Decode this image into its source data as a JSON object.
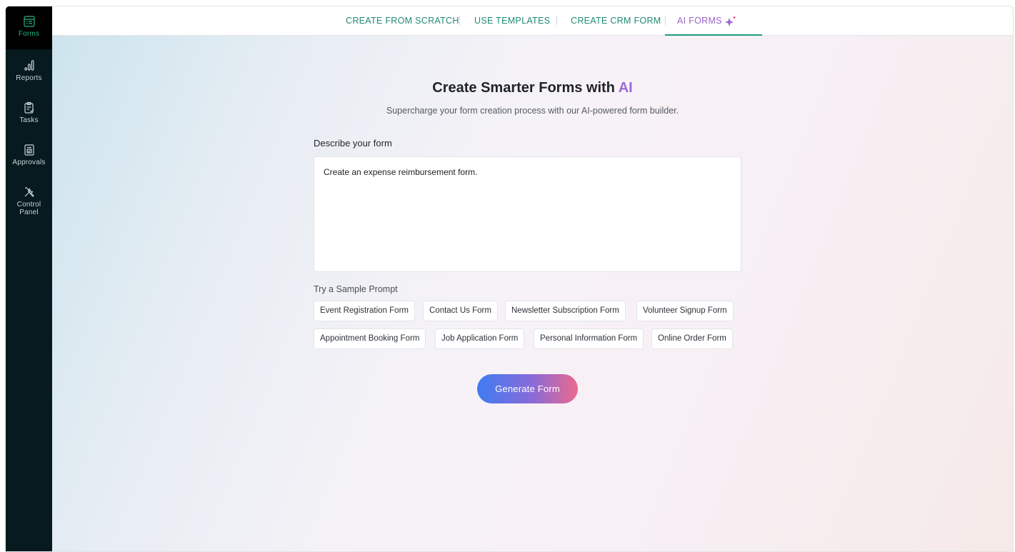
{
  "sidebar": {
    "items": [
      {
        "label": "Forms",
        "icon": "forms-icon",
        "active": true
      },
      {
        "label": "Reports",
        "icon": "reports-icon"
      },
      {
        "label": "Tasks",
        "icon": "tasks-icon"
      },
      {
        "label": "Approvals",
        "icon": "approvals-icon"
      },
      {
        "label_line1": "Control",
        "label_line2": "Panel",
        "icon": "control-panel-icon"
      }
    ]
  },
  "topnav": {
    "tabs": [
      {
        "label": "CREATE FROM SCRATCH"
      },
      {
        "label": "USE TEMPLATES"
      },
      {
        "label": "CREATE CRM FORM"
      },
      {
        "label": "AI FORMS",
        "active": true
      }
    ]
  },
  "main": {
    "title_prefix": "Create Smarter Forms with ",
    "title_accent": "AI",
    "subtitle": "Supercharge your form creation process with our AI-powered form builder.",
    "describe_label": "Describe your form",
    "prompt_value": "Create an expense reimbursement form.",
    "sample_label": "Try a Sample Prompt",
    "samples": [
      "Event Registration Form",
      "Contact Us Form",
      "Newsletter Subscription Form",
      "Volunteer Signup Form",
      "Appointment Booking Form",
      "Job Application Form",
      "Personal Information Form",
      "Online Order Form"
    ],
    "generate_label": "Generate Form"
  },
  "colors": {
    "sidebar_bg": "#061a1f",
    "accent_green": "#27b27f",
    "tab_text": "#1e8a73",
    "ai_purple": "#9a6ad6",
    "button_gradient_start": "#3f7cf2",
    "button_gradient_end": "#ec6a8c"
  }
}
